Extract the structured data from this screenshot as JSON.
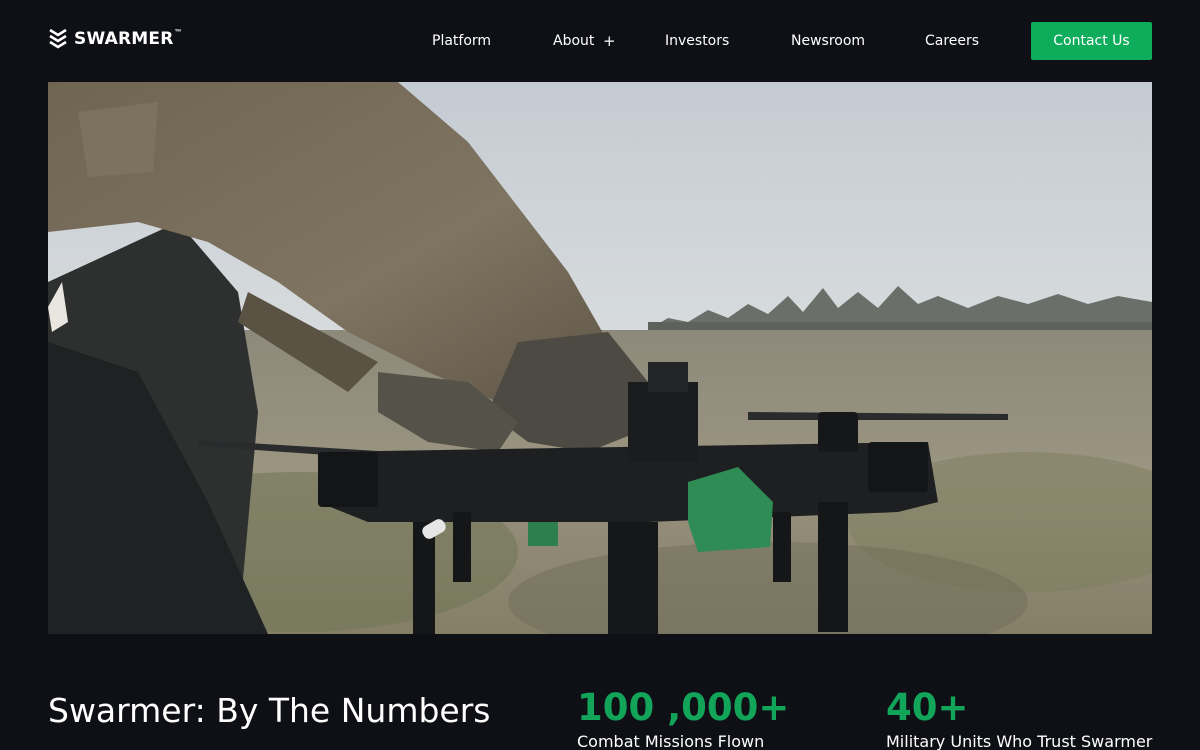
{
  "brand": {
    "name": "SWARMER",
    "trademark": "™",
    "icon": "swarmer-chevron-logo-icon"
  },
  "nav": {
    "items": [
      {
        "label": "Platform"
      },
      {
        "label": "About",
        "expand_icon": "+"
      },
      {
        "label": "Investors"
      },
      {
        "label": "Newsroom"
      },
      {
        "label": "Careers"
      }
    ],
    "cta_label": "Contact Us"
  },
  "hero": {
    "image": "soldier-preparing-hexacopter-drone-in-field-photo"
  },
  "stats_section": {
    "title": "Swarmer: By The Numbers",
    "stats": [
      {
        "value": "100 ,000+",
        "label": "Combat Missions Flown"
      },
      {
        "value": "40+",
        "label": "Military Units Who Trust Swarmer"
      }
    ]
  },
  "colors": {
    "background": "#0e1015",
    "accent": "#0ead5c",
    "stat_value": "#12a55a",
    "text": "#ffffff"
  }
}
